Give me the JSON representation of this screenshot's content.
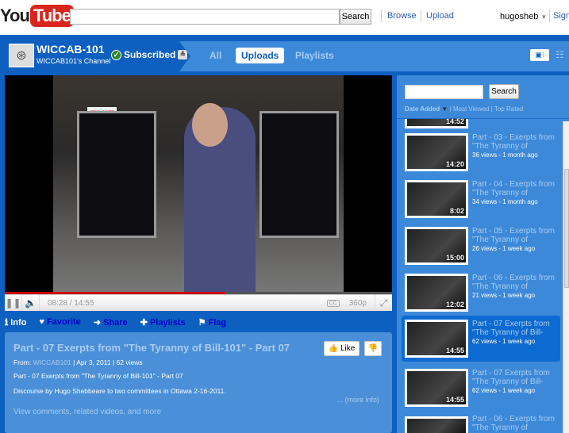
{
  "header": {
    "logo_you": "You",
    "logo_tube": "Tube",
    "search_placeholder": "",
    "search_button": "Search",
    "browse": "Browse",
    "upload": "Upload",
    "username": "hugosheb",
    "sign_out": "Sign"
  },
  "channel": {
    "name": "WICCAB-101",
    "subtitle": "WICCAB101's Channel",
    "subscribed": "Subscribed",
    "tabs": [
      "All",
      "Uploads",
      "Playlists"
    ],
    "active_tab": "Uploads"
  },
  "player": {
    "time": "08:28 / 14:55",
    "quality": "360p",
    "cc": "CC",
    "exit_sign": "EXIT",
    "progress": 0.57
  },
  "actions": {
    "info": "Info",
    "favorite": "Favorite",
    "share": "Share",
    "playlists": "Playlists",
    "flag": "Flag"
  },
  "video": {
    "title": "Part - 07 Exerpts from \"The Tyranny of Bill-101\" - Part 07",
    "from_label": "From:",
    "channel": "WICCAB101",
    "date": "| Apr 3, 2011",
    "views": "| 62 views",
    "desc1": "Part - 07 Exerpts from \"The Tyranny of Bill-101\" - Part 07",
    "desc2": "Discourse by Hugo Shebbeare to two committees in Ottawa 2-16-2011.",
    "more_info": "... (more info)",
    "view_comments": "View comments, related videos, and more",
    "like": "Like"
  },
  "sidebar": {
    "search_button": "Search",
    "sort": {
      "date_added": "Date Added",
      "most_viewed": "Most Viewed",
      "top_rated": "Top Rated"
    },
    "items": [
      {
        "title": "",
        "views": "",
        "duration": "14:52",
        "selected": false
      },
      {
        "title": "Part - 03 - Exerpts from \"The Tyranny of",
        "views": "36 views - 1 month ago",
        "duration": "14:20",
        "selected": false
      },
      {
        "title": "Part - 04 - Exerpts from \"The Tyranny of",
        "views": "34 views - 1 month ago",
        "duration": "8:02",
        "selected": false
      },
      {
        "title": "Part - 05 - Exerpts from \"The Tyranny of",
        "views": "26 views - 1 week ago",
        "duration": "15:00",
        "selected": false
      },
      {
        "title": "Part - 06 - Exerpts from \"The Tyranny of",
        "views": "21 views - 1 week ago",
        "duration": "12:02",
        "selected": false
      },
      {
        "title": "Part - 07 Exerpts from \"The Tyranny of Bill-",
        "views": "62 views - 1 week ago",
        "duration": "14:55",
        "selected": true
      },
      {
        "title": "Part - 07 Exerpts from \"The Tyranny of Bill-",
        "views": "62 views - 1 week ago",
        "duration": "14:55",
        "selected": false
      },
      {
        "title": "Part - 06 - Exerpts from \"The Tyranny of",
        "views": "",
        "duration": "",
        "selected": false
      }
    ]
  }
}
